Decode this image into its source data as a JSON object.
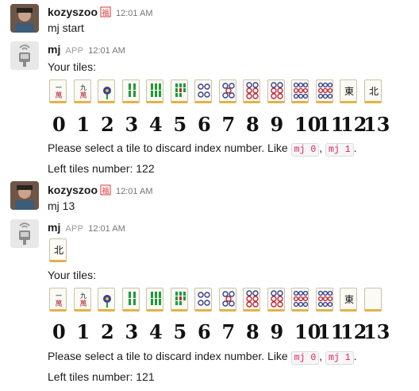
{
  "messages": [
    {
      "user": "kozyszoo",
      "time": "12:01 AM",
      "text": "mj start"
    },
    {
      "user": "mj",
      "app_tag": "APP",
      "time": "12:01 AM",
      "intro": "Your tiles:",
      "tiles": [
        "1-character",
        "9-character",
        "3-dots-flower",
        "4-bamboo",
        "6-bamboo",
        "8-bamboo",
        "4-dots",
        "5-dots",
        "6-dots",
        "6-dots",
        "9-dots",
        "9-dots",
        "east",
        "north"
      ],
      "indexes": [
        "0",
        "1",
        "2",
        "3",
        "4",
        "5",
        "6",
        "7",
        "8",
        "9",
        "10",
        "11",
        "12",
        "13"
      ],
      "prompt_pre": "Please select a tile to discard index number. Like",
      "code1": "mj 0",
      "comma": ",",
      "code2": "mj 1",
      "prompt_post": ".",
      "left_tiles": "Left tiles number: 122"
    },
    {
      "user": "kozyszoo",
      "time": "12:01 AM",
      "text": "mj 13"
    },
    {
      "user": "mj",
      "app_tag": "APP",
      "time": "12:01 AM",
      "discard_tile": "north",
      "intro": "Your tiles:",
      "tiles": [
        "1-character",
        "9-character",
        "3-dots-flower",
        "4-bamboo",
        "6-bamboo",
        "8-bamboo",
        "4-dots",
        "5-dots",
        "6-dots",
        "6-dots",
        "9-dots",
        "9-dots",
        "east",
        "white-dragon"
      ],
      "indexes": [
        "0",
        "1",
        "2",
        "3",
        "4",
        "5",
        "6",
        "7",
        "8",
        "9",
        "10",
        "11",
        "12",
        "13"
      ],
      "prompt_pre": "Please select a tile to discard index number. Like",
      "code1": "mj 0",
      "comma": ",",
      "code2": "mj 1",
      "prompt_post": ".",
      "left_tiles": "Left tiles number: 121"
    }
  ],
  "tile_glyphs": {
    "1-character": "一萬",
    "9-character": "九萬",
    "east": "東",
    "north": "北"
  },
  "colors": {
    "mention_code": "#e01e5a",
    "tile_border": "#e2b24a",
    "bamboo_green": "#1f9a3a",
    "dot_blue": "#3a3f8f",
    "dot_red": "#c0283a"
  }
}
